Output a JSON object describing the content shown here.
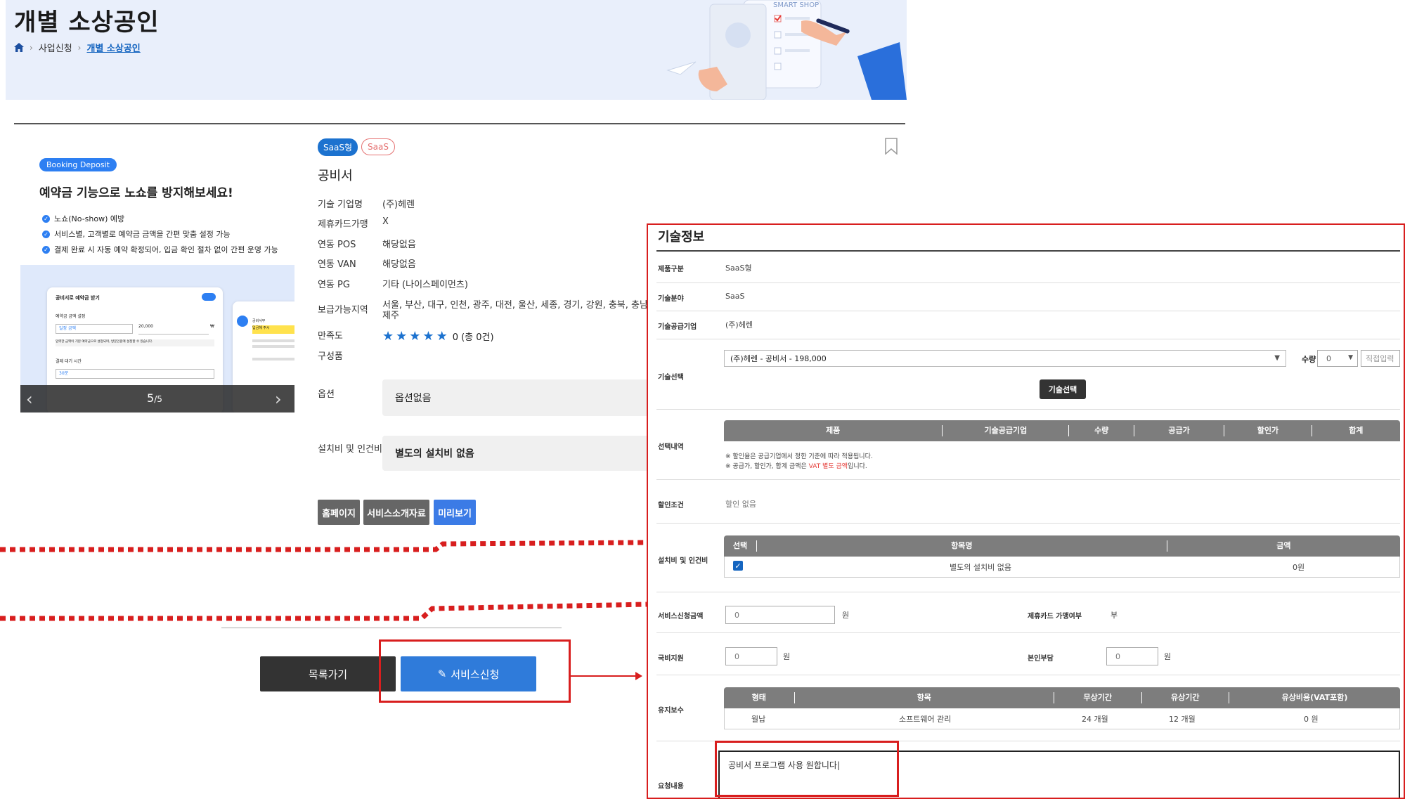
{
  "header": {
    "title": "개별 소상공인",
    "breadcrumb": [
      "사업신청",
      "개별 소상공인"
    ],
    "illustration_text": "SMART SHOP"
  },
  "promo": {
    "badge": "Booking Deposit",
    "title": "예약금 기능으로 노쇼를 방지해보세요!",
    "bullets": [
      "노쇼(No-show) 예방",
      "서비스별, 고객별로 예약금 금액을 간편 맞춤 설정 가능",
      "결제 완료 시 자동 예약 확정되어, 입금 확인 절차 없이 간편 운영 가능"
    ],
    "mock_title": "공비서로 예약금 받기",
    "mock_amount_label": "예약금 금액 설정",
    "mock_amount_select": "일정 금액",
    "mock_amount_value": "20,000",
    "mock_currency": "₩",
    "mock_note": "입력한 금액이 기본 예약금으로 설정되며, 방문인원에 설정할 수 있습니다.",
    "mock_wait_label": "결제 대기 시간",
    "mock_wait_value": "30분",
    "mock2_title": "공비서부",
    "mock2_highlight": "입금해 주시",
    "slide_current": "5",
    "slide_total": "/5"
  },
  "product": {
    "tags": [
      "SaaS형",
      "SaaS"
    ],
    "name": "공비서",
    "fields": [
      {
        "label": "기술 기업명",
        "value": "(주)헤렌"
      },
      {
        "label": "제휴카드가맹",
        "value": "X"
      },
      {
        "label": "연동 POS",
        "value": "해당없음"
      },
      {
        "label": "연동 VAN",
        "value": "해당없음"
      },
      {
        "label": "연동 PG",
        "value": "기타 (나이스페이먼츠)"
      },
      {
        "label": "보급가능지역",
        "value": "서울, 부산, 대구, 인천, 광주, 대전, 울산, 세종, 경기, 강원, 충북, 충남, 전북"
      },
      {
        "label": "",
        "value": "제주"
      }
    ],
    "satisfaction_label": "만족도",
    "satisfaction_stars": 5,
    "satisfaction_text": "0 (총 0건)",
    "components_label": "구성품",
    "option_label": "옵션",
    "option_value": "옵션없음",
    "install_label": "설치비 및 인건비",
    "install_value": "별도의 설치비 없음",
    "buttons": [
      "홈페이지",
      "서비스소개자료",
      "미리보기"
    ]
  },
  "actions": {
    "list_label": "목록가기",
    "apply_label": "서비스신청"
  },
  "tech": {
    "title": "기술정보",
    "product_type_label": "제품구분",
    "product_type_value": "SaaS형",
    "field_label": "기술분야",
    "field_value": "SaaS",
    "supplier_label": "기술공급기업",
    "supplier_value": "(주)헤렌",
    "select_label": "기술선택",
    "select_value": "(주)헤렌 - 공비서 - 198,000",
    "qty_label": "수량",
    "qty_value": "0",
    "direct_input": "직접입력",
    "select_button": "기술선택",
    "selection_label": "선택내역",
    "selection_headers": [
      "제품",
      "기술공급기업",
      "수량",
      "공급가",
      "할인가",
      "합계"
    ],
    "note1": "※ 할인율은 공급기업에서 정한 기준에 따라 적용됩니다.",
    "note2_prefix": "※ 공급가, 할인가, 합계 금액은 ",
    "note2_red": "VAT 별도 금액",
    "note2_suffix": "입니다.",
    "discount_label": "할인조건",
    "discount_value": "할인 없음",
    "install_label": "설치비 및 인건비",
    "install_headers": [
      "선택",
      "항목명",
      "금액"
    ],
    "install_item": "별도의 설치비 없음",
    "install_amount": "0원",
    "apply_amount_label": "서비스신청금액",
    "apply_amount_value": "0",
    "won": "원",
    "card_label": "제휴카드 가맹여부",
    "card_value": "부",
    "gov_label": "국비지원",
    "gov_value": "0",
    "self_label": "본인부담",
    "self_value": "0",
    "maint_label": "유지보수",
    "maint_headers": [
      "형태",
      "항목",
      "무상기간",
      "유상기간",
      "유상비용(VAT포함)"
    ],
    "maint_row": [
      "월납",
      "소프트웨어 관리",
      "24 개월",
      "12 개월",
      "0 원"
    ],
    "request_label": "요청내용",
    "request_value": "공비서 프로그램 사용 원합니다|"
  },
  "colors": {
    "accent": "#2f7bda",
    "highlight": "#d81e1e",
    "banner": "#e9effb"
  }
}
